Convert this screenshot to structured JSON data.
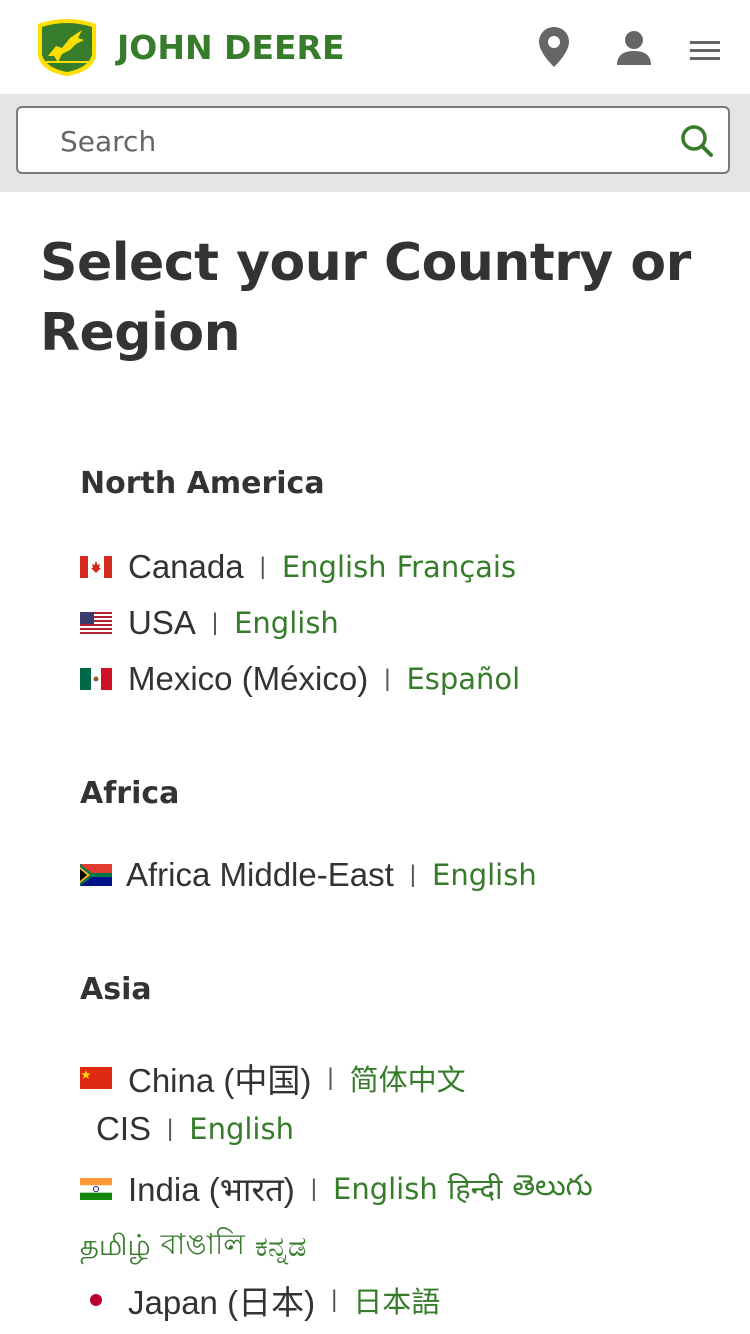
{
  "header": {
    "brand": "JOHN DEERE",
    "icons": {
      "location": "location-pin-icon",
      "account": "user-icon",
      "menu": "hamburger-menu-icon"
    }
  },
  "search": {
    "placeholder": "Search",
    "icon": "search-icon"
  },
  "colors": {
    "brand_green": "#367c2b",
    "brand_yellow": "#ffde00",
    "text": "#333333",
    "search_band": "#e5e5e5"
  },
  "title": "Select your Country or Region",
  "regions": {
    "north_america": {
      "heading": "North America",
      "countries": [
        {
          "name": "Canada",
          "separator": "|",
          "languages": [
            "English",
            "Français"
          ]
        },
        {
          "name": "USA",
          "separator": "|",
          "languages": [
            "English"
          ]
        },
        {
          "name": "Mexico (México)",
          "separator": "|",
          "languages": [
            "Español"
          ]
        }
      ]
    },
    "africa": {
      "heading": "Africa",
      "countries": [
        {
          "name": "Africa Middle-East",
          "separator": "|",
          "languages": [
            "English"
          ]
        }
      ]
    },
    "asia": {
      "heading": "Asia",
      "countries": [
        {
          "name": "China (中国)",
          "separator": "|",
          "languages": [
            "简体中文"
          ]
        },
        {
          "name": "CIS",
          "separator": "|",
          "languages": [
            "English"
          ]
        },
        {
          "name": "India (भारत)",
          "separator": "|",
          "languages": [
            "English",
            "हिन्दी",
            "తెలుగు",
            "தமிழ்",
            "বাঙালি",
            "ಕನ್ನಡ"
          ]
        },
        {
          "name": "Japan (日本)",
          "separator": "|",
          "languages": [
            "日本語"
          ]
        }
      ]
    }
  }
}
